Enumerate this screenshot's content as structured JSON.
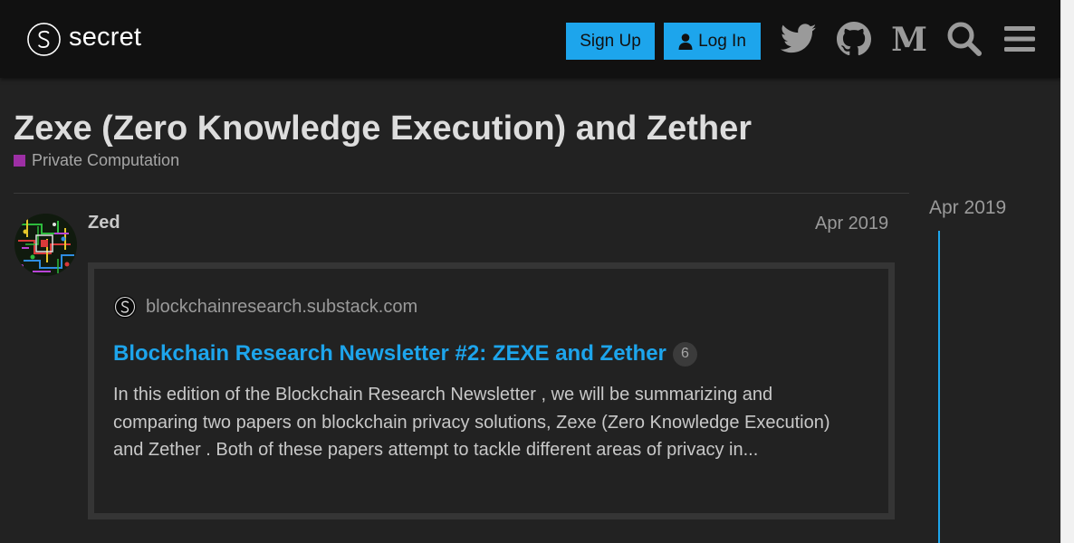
{
  "header": {
    "logo_text": "secret",
    "signup_label": "Sign Up",
    "login_label": "Log In",
    "icons": [
      "twitter-icon",
      "github-icon",
      "medium-icon",
      "search-icon",
      "hamburger-menu-icon"
    ]
  },
  "topic": {
    "title": "Zexe (Zero Knowledge Execution) and Zether",
    "category": "Private Computation",
    "category_color": "#9d2fa5"
  },
  "post": {
    "username": "Zed",
    "date": "Apr 2019",
    "onebox": {
      "source": "blockchainresearch.substack.com",
      "title": "Blockchain Research Newsletter #2: ZEXE and Zether",
      "click_count": "6",
      "excerpt": "In this edition of the Blockchain Research Newsletter , we will be summarizing and comparing two papers on blockchain privacy solutions, Zexe (Zero Knowledge Execution) and Zether . Both of these papers attempt to tackle different areas of privacy in..."
    }
  },
  "timeline": {
    "date": "Apr 2019"
  },
  "colors": {
    "accent": "#1da5ec",
    "background": "#222222",
    "header_bg": "#111111"
  }
}
